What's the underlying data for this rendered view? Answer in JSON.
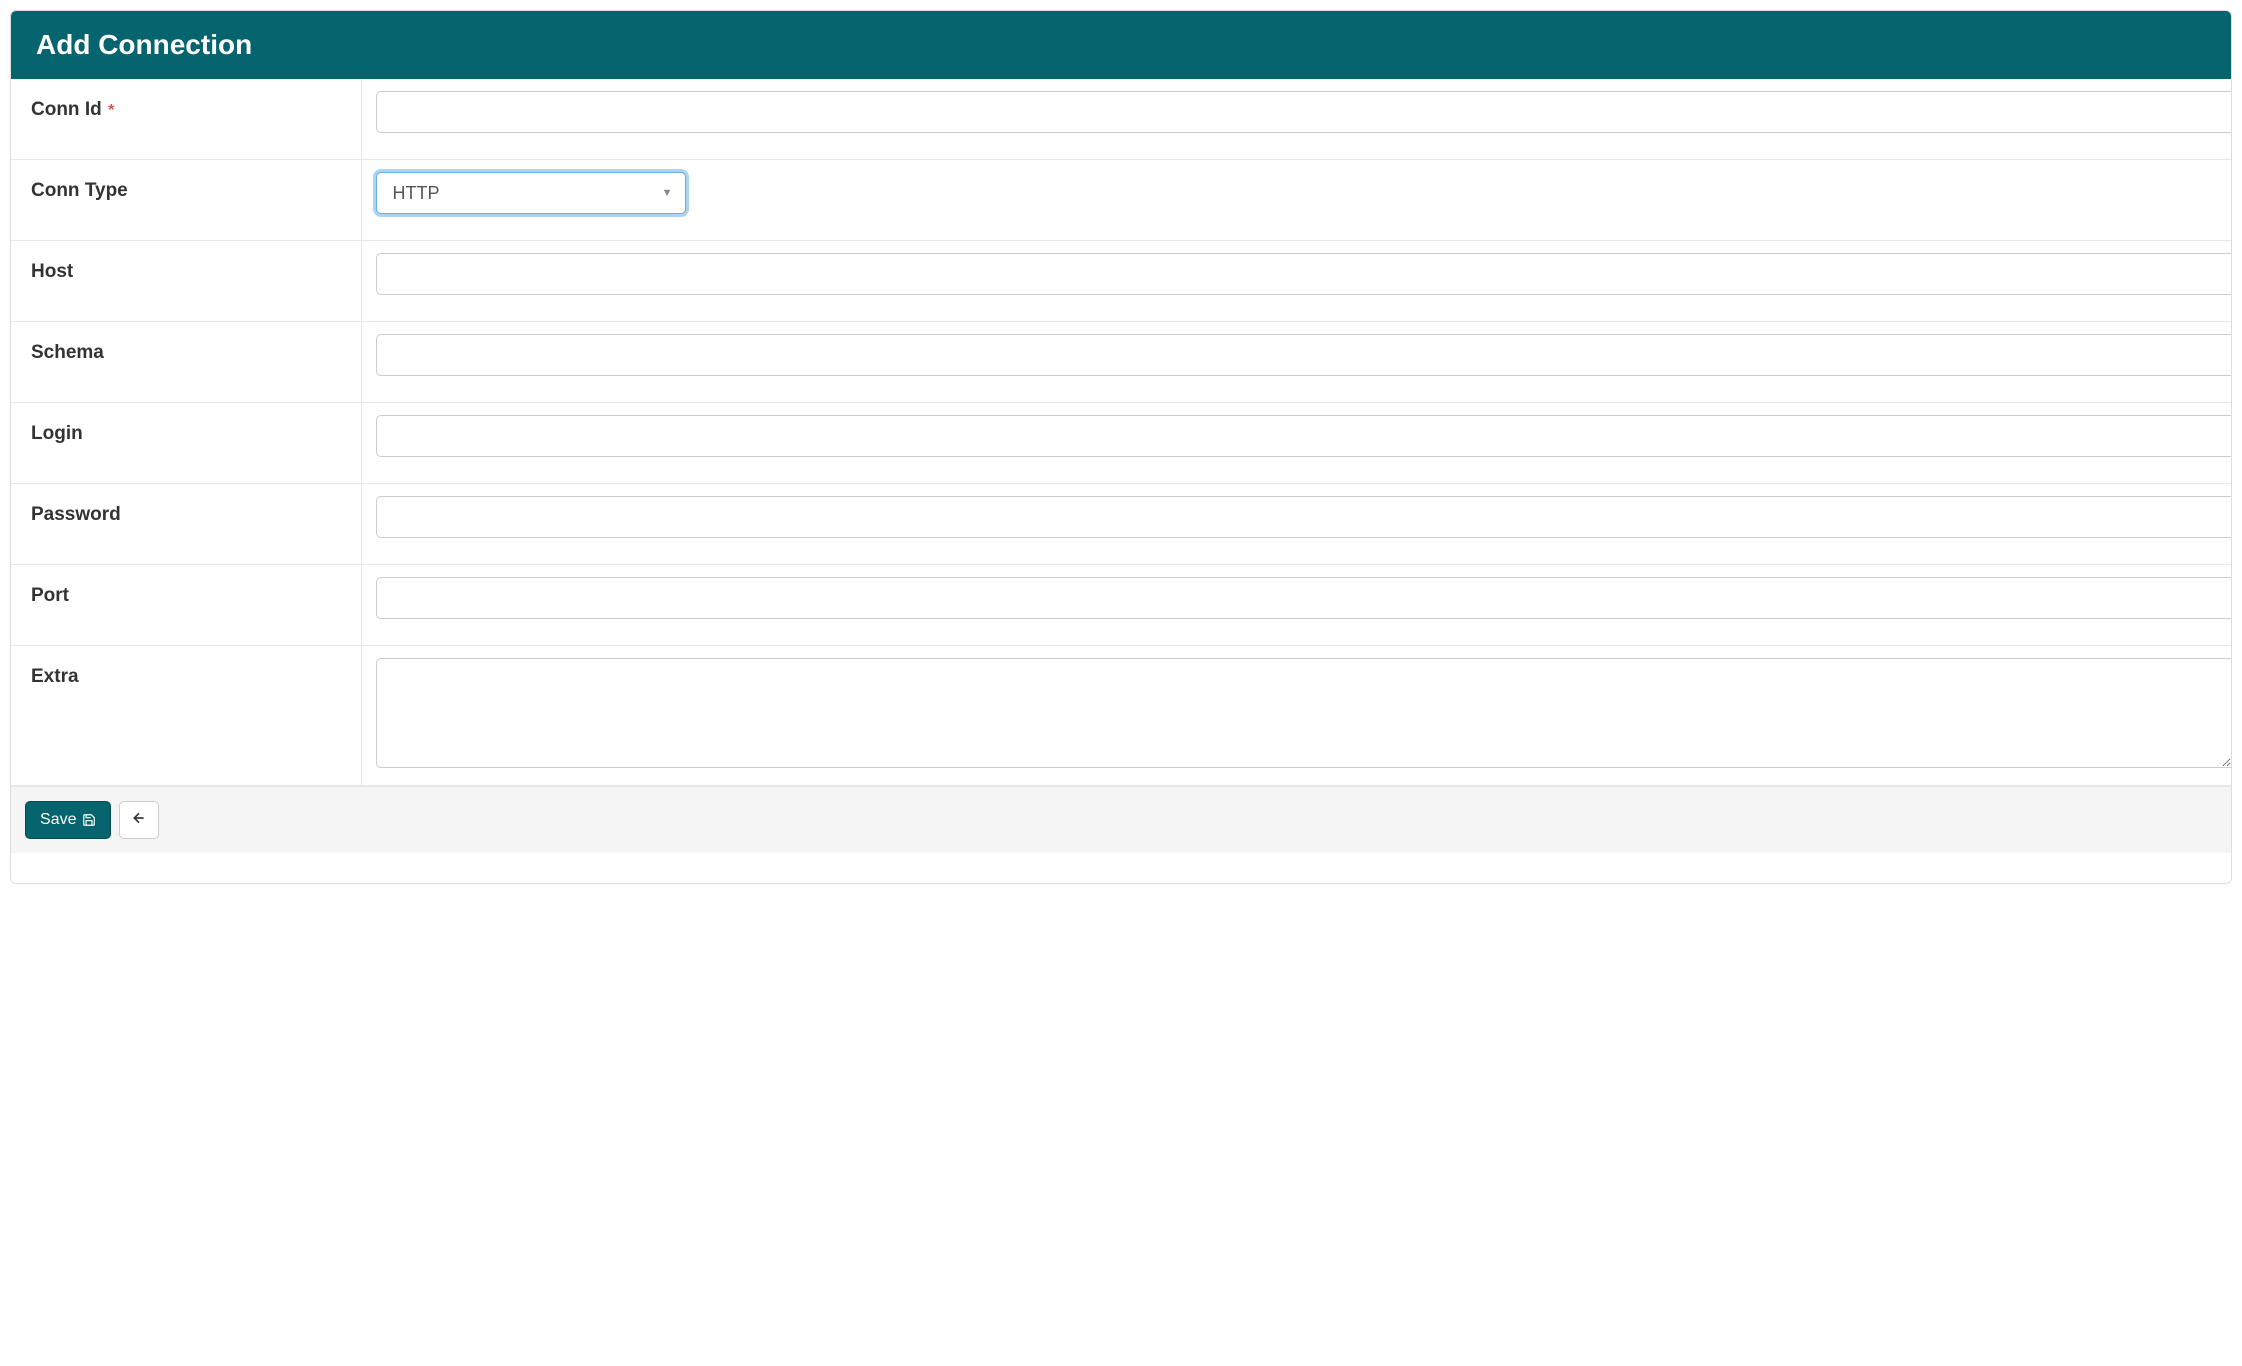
{
  "header": {
    "title": "Add Connection"
  },
  "form": {
    "conn_id": {
      "label": "Conn Id",
      "required": true,
      "value": ""
    },
    "conn_type": {
      "label": "Conn Type",
      "selected": "HTTP"
    },
    "host": {
      "label": "Host",
      "value": ""
    },
    "schema": {
      "label": "Schema",
      "value": ""
    },
    "login": {
      "label": "Login",
      "value": ""
    },
    "password": {
      "label": "Password",
      "value": ""
    },
    "port": {
      "label": "Port",
      "value": ""
    },
    "extra": {
      "label": "Extra",
      "value": ""
    }
  },
  "footer": {
    "save_label": "Save"
  },
  "required_marker": "*"
}
